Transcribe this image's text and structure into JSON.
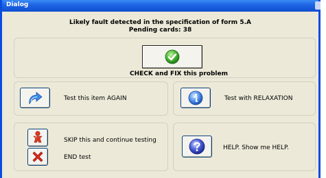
{
  "window": {
    "title": "Dialog"
  },
  "header": {
    "line1": "Likely fault detected in the specification of form 5.A",
    "line2": "Pending cards: 38"
  },
  "actions": {
    "check_fix": "CHECK and FIX this problem",
    "test_again": "Test this item AGAIN",
    "test_relaxation": "Test with RELAXATION",
    "skip": "SKIP this and continue testing",
    "end": "END test",
    "help": "HELP. Show me HELP."
  },
  "icons": {
    "check_fix": "green-check-icon",
    "test_again": "blue-redo-arrow-icon",
    "test_relaxation": "info-icon",
    "skip": "red-person-icon",
    "end": "red-x-icon",
    "help": "help-question-icon"
  },
  "colors": {
    "titlebar": "#0f4fd0",
    "dialog_bg": "#ece9d8",
    "check_green": "#3ea62b",
    "info_blue": "#2f6fd8",
    "danger_red": "#d8261c"
  }
}
